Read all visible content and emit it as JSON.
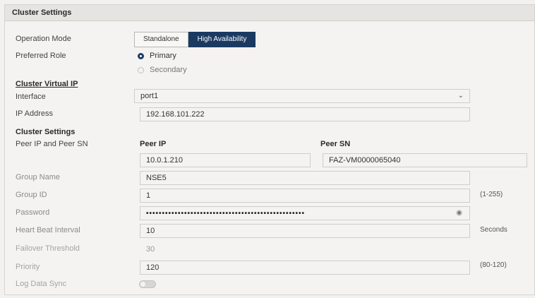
{
  "header": {
    "title": "Cluster Settings"
  },
  "operation_mode": {
    "label": "Operation Mode",
    "options": [
      "Standalone",
      "High Availability"
    ],
    "selected": "High Availability"
  },
  "preferred_role": {
    "label": "Preferred Role",
    "options": [
      "Primary",
      "Secondary"
    ],
    "selected": "Primary"
  },
  "cluster_virtual_ip": {
    "heading": "Cluster Virtual IP",
    "interface_label": "Interface",
    "interface_value": "port1",
    "ip_label": "IP Address",
    "ip_value": "192.168.101.222"
  },
  "cluster_settings": {
    "heading": "Cluster Settings",
    "peer_label": "Peer IP and Peer SN",
    "peer_ip_header": "Peer IP",
    "peer_sn_header": "Peer SN",
    "peer_ip_value": "10.0.1.210",
    "peer_sn_value": "FAZ-VM0000065040",
    "group_name_label": "Group Name",
    "group_name_value": "NSE5",
    "group_id_label": "Group ID",
    "group_id_value": "1",
    "group_id_hint": "(1-255)",
    "password_label": "Password",
    "password_mask": "••••••••••••••••••••••••••••••••••••••••••••••••••",
    "heartbeat_label": "Heart Beat Interval",
    "heartbeat_value": "10",
    "heartbeat_hint": "Seconds",
    "failover_label": "Failover Threshold",
    "failover_value": "30",
    "priority_label": "Priority",
    "priority_value": "120",
    "priority_hint": "(80-120)",
    "log_sync_label": "Log Data Sync",
    "log_sync_enabled": false
  },
  "icons": {
    "dropdown": "chevron-down-icon",
    "password_reveal": "eye-icon"
  },
  "colors": {
    "accent": "#1a3a62",
    "background": "#f4f3f1"
  }
}
